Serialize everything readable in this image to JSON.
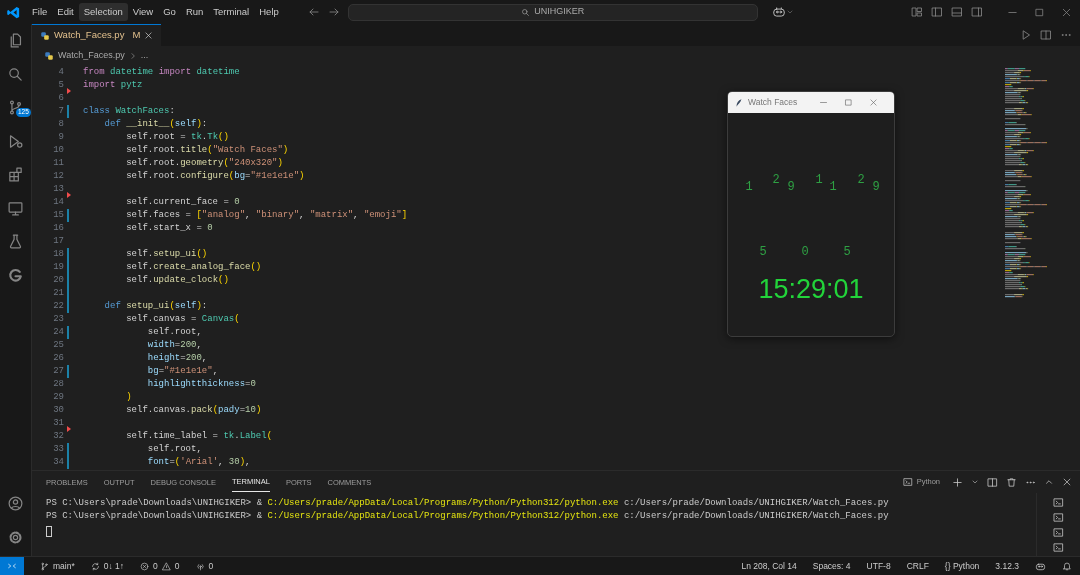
{
  "title_bar": {
    "menu": [
      {
        "label": "File",
        "selected": false
      },
      {
        "label": "Edit",
        "selected": false
      },
      {
        "label": "Selection",
        "selected": true
      },
      {
        "label": "View",
        "selected": false
      },
      {
        "label": "Go",
        "selected": false
      },
      {
        "label": "Run",
        "selected": false
      },
      {
        "label": "Terminal",
        "selected": false
      },
      {
        "label": "Help",
        "selected": false
      }
    ],
    "command_center": "UNIHGIKER"
  },
  "activity_bar": {
    "top": [
      {
        "kind": "explorer"
      },
      {
        "kind": "search"
      },
      {
        "kind": "source-control",
        "badge": "125"
      },
      {
        "kind": "debug"
      },
      {
        "kind": "extensions"
      },
      {
        "kind": "remote"
      },
      {
        "kind": "testing"
      },
      {
        "kind": "ring"
      }
    ],
    "bottom": [
      {
        "kind": "account"
      },
      {
        "kind": "settings"
      }
    ]
  },
  "tabs": [
    {
      "label": "Watch_Faces.py",
      "badge": "M",
      "selected": true
    }
  ],
  "breadcrumb": [
    "Watch_Faces.py",
    "..."
  ],
  "editor": {
    "lines": [
      {
        "number": "4",
        "modified": false,
        "deleted": false,
        "tokens": [
          {
            "text": "from",
            "kind": "ctl"
          },
          {
            "text": " datetime ",
            "kind": "cls"
          },
          {
            "text": "import",
            "kind": "ctl"
          },
          {
            "text": " datetime",
            "kind": "cls"
          }
        ]
      },
      {
        "number": "5",
        "modified": false,
        "deleted": true,
        "tokens": [
          {
            "text": "import",
            "kind": "ctl"
          },
          {
            "text": " pytz",
            "kind": "cls"
          }
        ]
      },
      {
        "number": "6",
        "modified": false,
        "deleted": false
      },
      {
        "number": "7",
        "modified": true,
        "deleted": false,
        "tokens": [
          {
            "text": "class",
            "kind": "kw"
          },
          {
            "text": " WatchFaces",
            "kind": "cls"
          },
          {
            "text": ":",
            "kind": "p"
          }
        ]
      },
      {
        "number": "8",
        "modified": false,
        "deleted": false,
        "tokens": [
          {
            "text": "    def",
            "kind": "kw"
          },
          {
            "text": " __init__",
            "kind": "fn"
          },
          {
            "text": "(",
            "kind": "brk"
          },
          {
            "text": "self",
            "kind": "var"
          },
          {
            "text": ")",
            "kind": "brk"
          },
          {
            "text": ":",
            "kind": "p"
          }
        ]
      },
      {
        "number": "9",
        "modified": false,
        "deleted": false,
        "tokens": [
          {
            "text": "        self.root = ",
            "kind": "p"
          },
          {
            "text": "tk",
            "kind": "cls"
          },
          {
            "text": ".",
            "kind": "p"
          },
          {
            "text": "Tk",
            "kind": "cls"
          },
          {
            "text": "()",
            "kind": "brk"
          }
        ]
      },
      {
        "number": "10",
        "modified": false,
        "deleted": false,
        "tokens": [
          {
            "text": "        self.root.",
            "kind": "p"
          },
          {
            "text": "title",
            "kind": "fn"
          },
          {
            "text": "(",
            "kind": "brk"
          },
          {
            "text": "\"Watch Faces\"",
            "kind": "str"
          },
          {
            "text": ")",
            "kind": "brk"
          }
        ]
      },
      {
        "number": "11",
        "modified": false,
        "deleted": false,
        "tokens": [
          {
            "text": "        self.root.",
            "kind": "p"
          },
          {
            "text": "geometry",
            "kind": "fn"
          },
          {
            "text": "(",
            "kind": "brk"
          },
          {
            "text": "\"240x320\"",
            "kind": "str"
          },
          {
            "text": ")",
            "kind": "brk"
          }
        ]
      },
      {
        "number": "12",
        "modified": false,
        "deleted": false,
        "tokens": [
          {
            "text": "        self.root.",
            "kind": "p"
          },
          {
            "text": "configure",
            "kind": "fn"
          },
          {
            "text": "(",
            "kind": "brk"
          },
          {
            "text": "bg",
            "kind": "var"
          },
          {
            "text": "=",
            "kind": "p"
          },
          {
            "text": "\"#1e1e1e\"",
            "kind": "str"
          },
          {
            "text": ")",
            "kind": "brk"
          }
        ]
      },
      {
        "number": "13",
        "modified": false,
        "deleted": true
      },
      {
        "number": "14",
        "modified": false,
        "deleted": false,
        "tokens": [
          {
            "text": "        self.current_face = ",
            "kind": "p"
          },
          {
            "text": "0",
            "kind": "num"
          }
        ]
      },
      {
        "number": "15",
        "modified": true,
        "deleted": false,
        "tokens": [
          {
            "text": "        self.faces = ",
            "kind": "p"
          },
          {
            "text": "[",
            "kind": "brk"
          },
          {
            "text": "\"analog\"",
            "kind": "str"
          },
          {
            "text": ", ",
            "kind": "p"
          },
          {
            "text": "\"binary\"",
            "kind": "str"
          },
          {
            "text": ", ",
            "kind": "p"
          },
          {
            "text": "\"matrix\"",
            "kind": "str"
          },
          {
            "text": ", ",
            "kind": "p"
          },
          {
            "text": "\"emoji\"",
            "kind": "str"
          },
          {
            "text": "]",
            "kind": "brk"
          }
        ]
      },
      {
        "number": "16",
        "modified": false,
        "deleted": false,
        "tokens": [
          {
            "text": "        self.start_x = ",
            "kind": "p"
          },
          {
            "text": "0",
            "kind": "num"
          }
        ]
      },
      {
        "number": "17",
        "modified": false,
        "deleted": false
      },
      {
        "number": "18",
        "modified": true,
        "deleted": false,
        "tokens": [
          {
            "text": "        self.",
            "kind": "p"
          },
          {
            "text": "setup_ui",
            "kind": "fn"
          },
          {
            "text": "()",
            "kind": "brk"
          }
        ]
      },
      {
        "number": "19",
        "modified": true,
        "deleted": false,
        "tokens": [
          {
            "text": "        self.",
            "kind": "p"
          },
          {
            "text": "create_analog_face",
            "kind": "fn"
          },
          {
            "text": "()",
            "kind": "brk"
          }
        ]
      },
      {
        "number": "20",
        "modified": true,
        "deleted": false,
        "tokens": [
          {
            "text": "        self.",
            "kind": "p"
          },
          {
            "text": "update_clock",
            "kind": "fn"
          },
          {
            "text": "()",
            "kind": "brk"
          }
        ]
      },
      {
        "number": "21",
        "modified": true,
        "deleted": false
      },
      {
        "number": "22",
        "modified": true,
        "deleted": false,
        "tokens": [
          {
            "text": "    def",
            "kind": "kw"
          },
          {
            "text": " setup_ui",
            "kind": "fn"
          },
          {
            "text": "(",
            "kind": "brk"
          },
          {
            "text": "self",
            "kind": "var"
          },
          {
            "text": ")",
            "kind": "brk"
          },
          {
            "text": ":",
            "kind": "p"
          }
        ]
      },
      {
        "number": "23",
        "modified": false,
        "deleted": false,
        "tokens": [
          {
            "text": "        self.canvas = ",
            "kind": "p"
          },
          {
            "text": "Canvas",
            "kind": "cls"
          },
          {
            "text": "(",
            "kind": "brk"
          }
        ]
      },
      {
        "number": "24",
        "modified": true,
        "deleted": false,
        "tokens": [
          {
            "text": "            self.root,",
            "kind": "p"
          }
        ]
      },
      {
        "number": "25",
        "modified": false,
        "deleted": false,
        "tokens": [
          {
            "text": "            width",
            "kind": "var"
          },
          {
            "text": "=",
            "kind": "p"
          },
          {
            "text": "200",
            "kind": "num"
          },
          {
            "text": ",",
            "kind": "p"
          }
        ]
      },
      {
        "number": "26",
        "modified": false,
        "deleted": false,
        "tokens": [
          {
            "text": "            height",
            "kind": "var"
          },
          {
            "text": "=",
            "kind": "p"
          },
          {
            "text": "200",
            "kind": "num"
          },
          {
            "text": ",",
            "kind": "p"
          }
        ]
      },
      {
        "number": "27",
        "modified": true,
        "deleted": false,
        "tokens": [
          {
            "text": "            bg",
            "kind": "var"
          },
          {
            "text": "=",
            "kind": "p"
          },
          {
            "text": "\"#1e1e1e\"",
            "kind": "str"
          },
          {
            "text": ",",
            "kind": "p"
          }
        ]
      },
      {
        "number": "28",
        "modified": false,
        "deleted": false,
        "tokens": [
          {
            "text": "            highlightthickness",
            "kind": "var"
          },
          {
            "text": "=",
            "kind": "p"
          },
          {
            "text": "0",
            "kind": "num"
          }
        ]
      },
      {
        "number": "29",
        "modified": false,
        "deleted": false,
        "tokens": [
          {
            "text": "        )",
            "kind": "brk"
          }
        ]
      },
      {
        "number": "30",
        "modified": false,
        "deleted": false,
        "tokens": [
          {
            "text": "        self.canvas.",
            "kind": "p"
          },
          {
            "text": "pack",
            "kind": "fn"
          },
          {
            "text": "(",
            "kind": "brk"
          },
          {
            "text": "pady",
            "kind": "var"
          },
          {
            "text": "=",
            "kind": "p"
          },
          {
            "text": "10",
            "kind": "num"
          },
          {
            "text": ")",
            "kind": "brk"
          }
        ]
      },
      {
        "number": "31",
        "modified": false,
        "deleted": true
      },
      {
        "number": "32",
        "modified": false,
        "deleted": false,
        "tokens": [
          {
            "text": "        self.time_label = ",
            "kind": "p"
          },
          {
            "text": "tk",
            "kind": "cls"
          },
          {
            "text": ".",
            "kind": "p"
          },
          {
            "text": "Label",
            "kind": "cls"
          },
          {
            "text": "(",
            "kind": "brk"
          }
        ]
      },
      {
        "number": "33",
        "modified": true,
        "deleted": false,
        "tokens": [
          {
            "text": "            self.root,",
            "kind": "p"
          }
        ]
      },
      {
        "number": "34",
        "modified": true,
        "deleted": false,
        "tokens": [
          {
            "text": "            font",
            "kind": "var"
          },
          {
            "text": "=",
            "kind": "p"
          },
          {
            "text": "(",
            "kind": "brk"
          },
          {
            "text": "'Arial'",
            "kind": "str"
          },
          {
            "text": ", ",
            "kind": "p"
          },
          {
            "text": "30",
            "kind": "num"
          },
          {
            "text": ")",
            "kind": "brk"
          },
          {
            "text": ",",
            "kind": "p"
          }
        ]
      }
    ]
  },
  "tk_window": {
    "title": "Watch Faces",
    "matrix_rows": [
      [
        "1",
        "2",
        "9",
        "1",
        "1",
        "2",
        "9"
      ],
      [
        "5",
        "0",
        "5"
      ]
    ],
    "time": "15:29:01"
  },
  "panel": {
    "tabs": [
      {
        "label": "PROBLEMS",
        "selected": false
      },
      {
        "label": "OUTPUT",
        "selected": false
      },
      {
        "label": "DEBUG CONSOLE",
        "selected": false
      },
      {
        "label": "TERMINAL",
        "selected": true
      },
      {
        "label": "PORTS",
        "selected": false
      },
      {
        "label": "COMMENTS",
        "selected": false
      }
    ],
    "terminal_name": "Python",
    "lines": [
      {
        "prompt": "PS C:\\Users\\prade\\Downloads\\UNIHGIKER> & ",
        "exe": "C:/Users/prade/AppData/Local/Programs/Python/Python312/python.exe",
        "args": " c:/Users/prade/Downloads/UNIHGIKER/Watch_Faces.py"
      },
      {
        "prompt": "PS C:\\Users\\prade\\Downloads\\UNIHGIKER> & ",
        "exe": "C:/Users/prade/AppData/Local/Programs/Python/Python312/python.exe",
        "args": " c:/Users/prade/Downloads/UNIHGIKER/Watch_Faces.py"
      }
    ],
    "cursor_visible": true,
    "terminal_instances": [
      {
        "kind": "terminal"
      },
      {
        "kind": "terminal"
      },
      {
        "kind": "terminal"
      },
      {
        "kind": "terminal"
      }
    ]
  },
  "status_bar": {
    "branch": "main*",
    "sync": "0↓ 1↑",
    "errors": "0",
    "warnings": "0",
    "ports": "0",
    "position": "Ln 208, Col 14",
    "spaces": "Spaces: 4",
    "encoding": "UTF-8",
    "eol": "CRLF",
    "language": "{} Python",
    "version": "3.12.3"
  }
}
